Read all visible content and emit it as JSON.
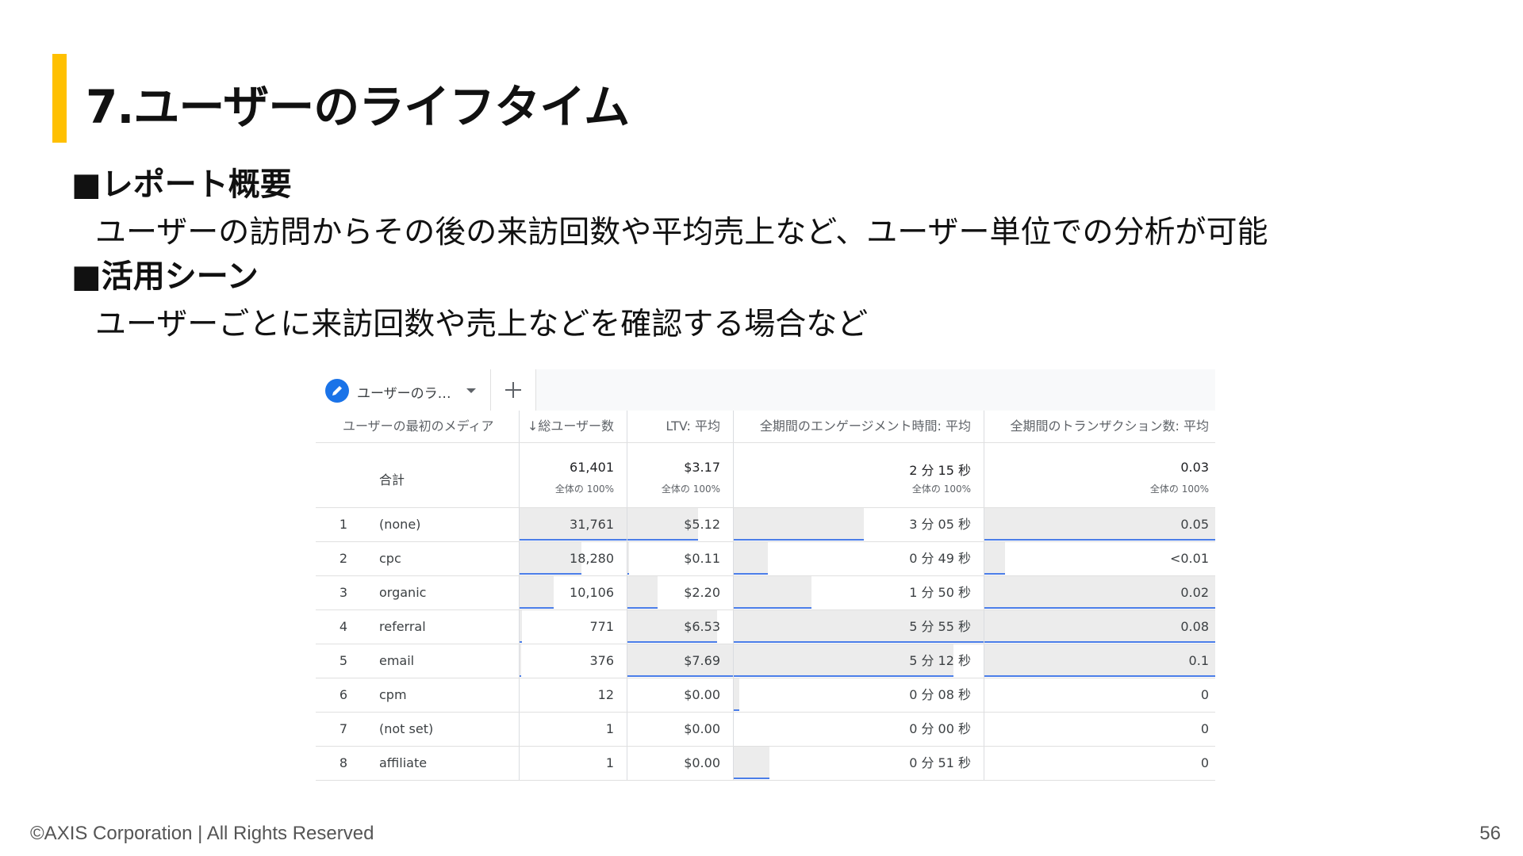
{
  "slide": {
    "title": "7.ユーザーのライフタイム",
    "section1_heading": "■レポート概要",
    "section1_text": "ユーザーの訪問からその後の来訪回数や平均売上など、ユーザー単位での分析が可能",
    "section2_heading": "■活用シーン",
    "section2_text": "ユーザーごとに来訪回数や売上などを確認する場合など",
    "footer": "©AXIS Corporation | All Rights Reserved",
    "page_number": "56",
    "accent_color": "#FFC000"
  },
  "report": {
    "tab_label": "ユーザーのラ…",
    "tab_icon": "pencil-icon",
    "add_tab_icon": "plus-icon",
    "columns": [
      "ユーザーの最初のメディア",
      "↓総ユーザー数",
      "LTV: 平均",
      "全期間のエンゲージメント時間: 平均",
      "全期間のトランザクション数: 平均"
    ],
    "totals": {
      "label": "合計",
      "values": [
        "61,401",
        "$3.17",
        "2 分 15 秒",
        "0.03"
      ],
      "subs": [
        "全体の 100%",
        "全体の 100%",
        "全体の 100%",
        "全体の 100%"
      ]
    },
    "rows": [
      {
        "idx": "1",
        "medium": "(none)",
        "users": "31,761",
        "ltv": "$5.12",
        "engage": "3 分 05 秒",
        "trans": "0.05",
        "users_frac": 1.0,
        "ltv_frac": 0.666,
        "engage_frac": 0.52,
        "trans_frac": 1.0
      },
      {
        "idx": "2",
        "medium": "cpc",
        "users": "18,280",
        "ltv": "$0.11",
        "engage": "0 分 49 秒",
        "trans": "<0.01",
        "users_frac": 0.576,
        "ltv_frac": 0.014,
        "engage_frac": 0.138,
        "trans_frac": 0.09
      },
      {
        "idx": "3",
        "medium": "organic",
        "users": "10,106",
        "ltv": "$2.20",
        "engage": "1 分 50 秒",
        "trans": "0.02",
        "users_frac": 0.318,
        "ltv_frac": 0.286,
        "engage_frac": 0.31,
        "trans_frac": 1.0
      },
      {
        "idx": "4",
        "medium": "referral",
        "users": "771",
        "ltv": "$6.53",
        "engage": "5 分 55 秒",
        "trans": "0.08",
        "users_frac": 0.024,
        "ltv_frac": 0.849,
        "engage_frac": 1.0,
        "trans_frac": 1.0
      },
      {
        "idx": "5",
        "medium": "email",
        "users": "376",
        "ltv": "$7.69",
        "engage": "5 分 12 秒",
        "trans": "0.1",
        "users_frac": 0.012,
        "ltv_frac": 1.0,
        "engage_frac": 0.879,
        "trans_frac": 1.0
      },
      {
        "idx": "6",
        "medium": "cpm",
        "users": "12",
        "ltv": "$0.00",
        "engage": "0 分 08 秒",
        "trans": "0",
        "users_frac": 0,
        "ltv_frac": 0,
        "engage_frac": 0.023,
        "trans_frac": 0
      },
      {
        "idx": "7",
        "medium": "(not set)",
        "users": "1",
        "ltv": "$0.00",
        "engage": "0 分 00 秒",
        "trans": "0",
        "users_frac": 0,
        "ltv_frac": 0,
        "engage_frac": 0,
        "trans_frac": 0
      },
      {
        "idx": "8",
        "medium": "affiliate",
        "users": "1",
        "ltv": "$0.00",
        "engage": "0 分 51 秒",
        "trans": "0",
        "users_frac": 0,
        "ltv_frac": 0,
        "engage_frac": 0.144,
        "trans_frac": 0
      }
    ]
  }
}
